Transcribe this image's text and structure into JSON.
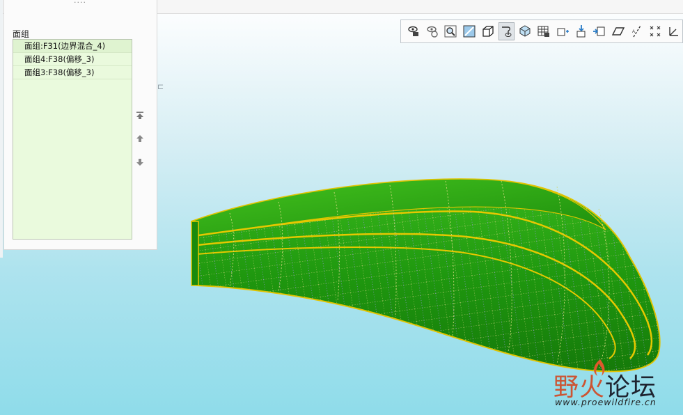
{
  "panel": {
    "grip": "····",
    "title": "面组",
    "items": [
      {
        "label": "面组:F31(边界混合_4)"
      },
      {
        "label": "面组4:F38(偏移_3)"
      },
      {
        "label": "面组3:F38(偏移_3)"
      }
    ],
    "buttons": [
      "move-to-top",
      "move-up",
      "move-down"
    ]
  },
  "toolbar": {
    "icons": [
      "view-manager-icon",
      "saved-orientations-icon",
      "refit-icon",
      "zoom-area-icon",
      "display-style-icon",
      "spin-center-icon",
      "named-views-icon",
      "appearance-gallery-icon",
      "layers-icon",
      "datum-display-icon",
      "annotation-display-icon",
      "plane-display-icon",
      "axis-display-icon",
      "point-display-icon",
      "csys-display-icon"
    ],
    "active_index": 5
  },
  "stray_mark": "⊏",
  "model": {
    "surface_color": "#1f9a12",
    "edge_color": "#e6c800",
    "mesh_color": "#9b9fd6"
  },
  "watermark": {
    "cn_first": "野火",
    "cn_second": "论坛",
    "url": "www.proewildfire.cn"
  }
}
